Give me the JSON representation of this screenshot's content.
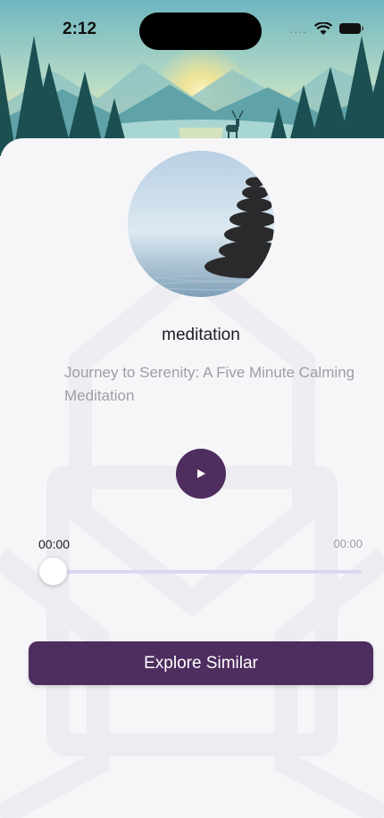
{
  "status_bar": {
    "time": "2:12",
    "signal_icon": "signal-dots-icon",
    "wifi_icon": "wifi-icon",
    "battery_icon": "battery-icon"
  },
  "header": {
    "image": "mountain-lake-landscape"
  },
  "player": {
    "cover_image": "stacked-stones-on-water",
    "title": "meditation",
    "subtitle": "Journey to Serenity: A Five Minute Calming Meditation",
    "play_icon": "play-icon",
    "time_current": "00:00",
    "time_total": "00:00",
    "progress": 0
  },
  "actions": {
    "explore_label": "Explore Similar"
  },
  "colors": {
    "accent": "#4e2d5f",
    "background": "#f6f6f9",
    "track": "#d8d9f1"
  }
}
